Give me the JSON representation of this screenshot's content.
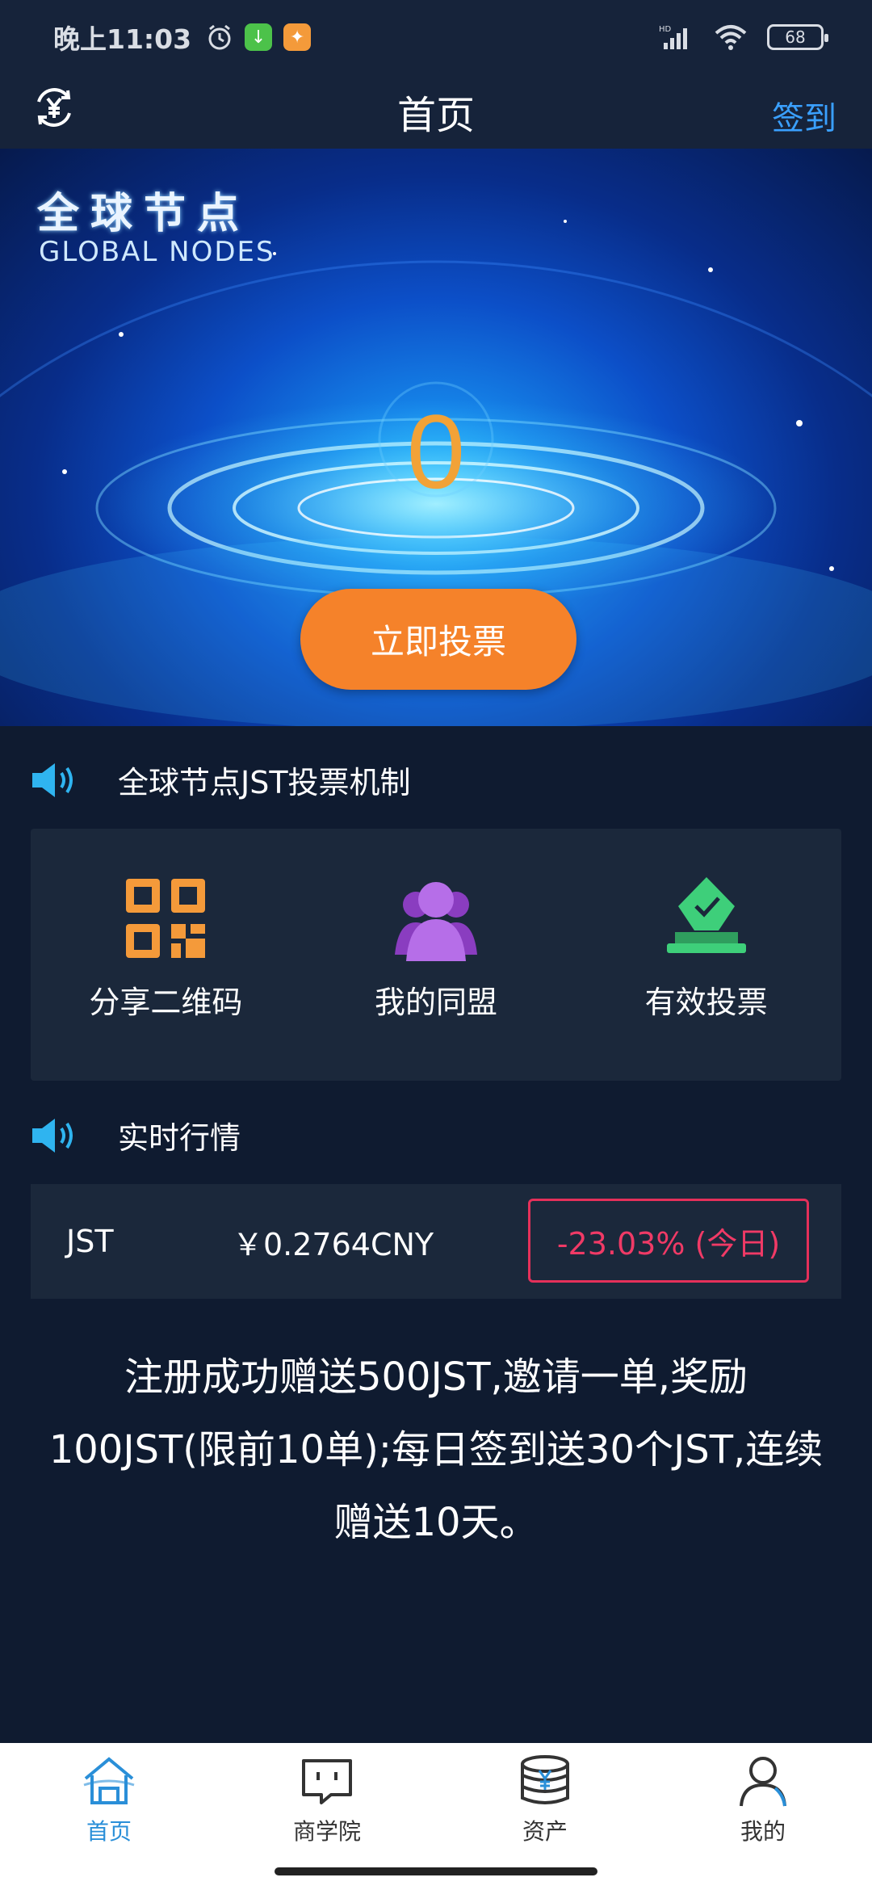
{
  "status_bar": {
    "time": "晚上11:03",
    "battery": "68",
    "icons": [
      "alarm-icon",
      "download-icon",
      "running-app-icon",
      "hd-signal-icon",
      "wifi-icon",
      "battery-icon"
    ]
  },
  "header": {
    "title": "首页",
    "checkin_label": "签到",
    "left_icon": "currency-exchange-icon"
  },
  "banner": {
    "logo_cn": "全球节点",
    "logo_en": "GLOBAL NODES",
    "count": "0",
    "vote_button": "立即投票"
  },
  "sections": {
    "mechanism_title": "全球节点JST投票机制",
    "market_title": "实时行情"
  },
  "features": [
    {
      "label": "分享二维码",
      "icon": "qr-code-icon"
    },
    {
      "label": "我的同盟",
      "icon": "group-icon"
    },
    {
      "label": "有效投票",
      "icon": "ballot-icon"
    }
  ],
  "market": {
    "symbol": "JST",
    "price": "￥0.2764CNY",
    "change": "-23.03% (今日)"
  },
  "promo_text": "注册成功赠送500JST,邀请一单,奖励100JST(限前10单);每日签到送30个JST,连续赠送10天。",
  "tabs": [
    {
      "label": "首页",
      "icon": "home-icon",
      "active": true
    },
    {
      "label": "商学院",
      "icon": "chat-icon",
      "active": false
    },
    {
      "label": "资产",
      "icon": "coins-icon",
      "active": false
    },
    {
      "label": "我的",
      "icon": "profile-icon",
      "active": false
    }
  ],
  "colors": {
    "accent_blue": "#3aa0ff",
    "vote_orange": "#f5822a",
    "count_orange": "#f2a237",
    "down_red": "#f03a66",
    "bg_dark": "#0f1b30"
  }
}
